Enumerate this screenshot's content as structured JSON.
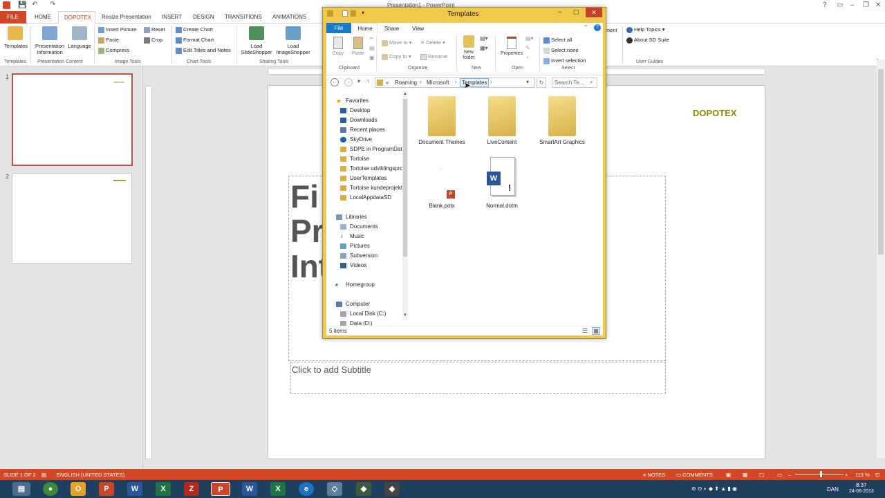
{
  "app": {
    "window_title": "Presentation1 - PowerPoint",
    "tabs": [
      "FILE",
      "HOME",
      "DOPOTEX",
      "Resize Presentation",
      "INSERT",
      "DESIGN",
      "TRANSITIONS",
      "ANIMATIONS"
    ],
    "ribbon": {
      "templates": "Templates",
      "presentation_information": "Presentation Information",
      "language": "Language",
      "insert_picture": "Insert Picture",
      "reset": "Reset",
      "paste": "Paste",
      "crop": "Crop",
      "compress": "Compress",
      "create_chart": "Create Chart",
      "format_chart": "Format Chart",
      "edit_titles": "Edit Titles and Notes",
      "load_slideshopper": "Load SlideShopper",
      "load_imageshopper": "Load ImageShopper",
      "help_topics": "Help Topics",
      "about_sd_suite": "About SD Suite",
      "ment_fragment": "ment",
      "group_labels": {
        "templates": "Templates",
        "presentation_content": "Presentation Content",
        "image_tools": "Image Tools",
        "chart_tools": "Chart Tools",
        "sharing_tools": "Sharing Tools",
        "user_guides": "User Guides"
      }
    },
    "slides": [
      {
        "number": "1",
        "logo": "DOPOTEX"
      },
      {
        "number": "2"
      }
    ],
    "slide": {
      "logo_text": "DOPOTEX",
      "title_lines": [
        "Fi",
        "Pr",
        "Int"
      ],
      "subtitle_placeholder": "Click to add Subtitle"
    },
    "status": {
      "slide_of": "SLIDE 1 OF 2",
      "language": "ENGLISH (UNITED STATES)",
      "notes": "NOTES",
      "comments": "COMMENTS",
      "zoom": "113 %"
    },
    "taskbar": {
      "language": "DAN",
      "time": "8:37",
      "date": "24-06-2013"
    }
  },
  "explorer": {
    "title": "Templates",
    "tabs": [
      "File",
      "Home",
      "Share",
      "View"
    ],
    "ribbon": {
      "copy": "Copy",
      "paste": "Paste",
      "move_to": "Move to",
      "copy_to": "Copy to",
      "delete": "Delete",
      "rename": "Rename",
      "new_folder": "New folder",
      "properties": "Properties",
      "select_all": "Select all",
      "select_none": "Select none",
      "invert_selection": "Invert selection",
      "groups": [
        "Clipboard",
        "Organize",
        "New",
        "Open",
        "Select"
      ]
    },
    "address": {
      "prefix": "«",
      "path": [
        "Roaming",
        "Microsoft",
        "Templates"
      ],
      "search_placeholder": "Search Te..."
    },
    "nav": {
      "favorites_header": "Favorites",
      "favorites": [
        "Desktop",
        "Downloads",
        "Recent places",
        "SkyDrive",
        "SDPE in ProgramData",
        "Tortoise",
        "Tortoise udviklingsproj",
        "UserTemplates",
        "Tortoise kundeprojekter",
        "LocalAppdataSD"
      ],
      "libraries_header": "Libraries",
      "libraries": [
        "Documents",
        "Music",
        "Pictures",
        "Subversion",
        "Videos"
      ],
      "homegroup": "Homegroup",
      "computer_header": "Computer",
      "drives": [
        "Local Disk (C:)",
        "Data (D:)"
      ]
    },
    "items": [
      {
        "name": "Document Themes",
        "kind": "folder"
      },
      {
        "name": "LiveContent",
        "kind": "folder"
      },
      {
        "name": "SmartArt Graphics",
        "kind": "folder"
      },
      {
        "name": "Blank.potx",
        "kind": "file"
      },
      {
        "name": "Normal.dotm",
        "kind": "file"
      }
    ],
    "status": "5 items"
  }
}
